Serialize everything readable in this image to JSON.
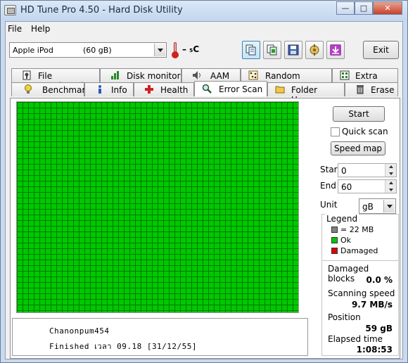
{
  "window": {
    "title": "HD Tune Pro 4.50 - Hard Disk Utility"
  },
  "titlebar_buttons": {
    "minimize": "—",
    "maximize": "□",
    "close": "✕"
  },
  "menu": {
    "file": "File",
    "help": "Help"
  },
  "toolbar": {
    "disk_name": "Apple   iPod",
    "disk_size": "(60 gB)",
    "temperature": "– ₅C",
    "exit_label": "Exit"
  },
  "tabs_top": [
    {
      "label": "File Benchmark",
      "icon": "file-benchmark-icon"
    },
    {
      "label": "Disk monitor",
      "icon": "disk-monitor-icon"
    },
    {
      "label": "AAM",
      "icon": "speaker-icon"
    },
    {
      "label": "Random Access",
      "icon": "random-access-icon"
    },
    {
      "label": "Extra tests",
      "icon": "extra-tests-icon"
    }
  ],
  "tabs_bottom": [
    {
      "label": "Benchmark",
      "icon": "lightbulb-icon"
    },
    {
      "label": "Info",
      "icon": "info-icon"
    },
    {
      "label": "Health",
      "icon": "health-cross-icon"
    },
    {
      "label": "Error Scan",
      "icon": "magnifier-icon",
      "selected": true
    },
    {
      "label": "Folder Usage",
      "icon": "folder-icon"
    },
    {
      "label": "Erase",
      "icon": "trash-icon"
    }
  ],
  "scan": {
    "start_button": "Start",
    "quick_scan_label": "Quick scan",
    "quick_scan_checked": false,
    "speed_map_button": "Speed map",
    "start_label": "Start",
    "start_value": "0",
    "end_label": "End",
    "end_value": "60",
    "unit_label": "Unit",
    "unit_value": "gB",
    "grid_status": "ok",
    "grid_color": "#00c800"
  },
  "legend": {
    "title": "Legend",
    "items": [
      {
        "label": "= 22 MB",
        "color": "#808080"
      },
      {
        "label": "Ok",
        "color": "#00c800"
      },
      {
        "label": "Damaged",
        "color": "#e00000"
      }
    ]
  },
  "stats": {
    "damaged_blocks_label": "Damaged blocks",
    "damaged_blocks_value": "0.0 %",
    "scanning_speed_label": "Scanning speed",
    "scanning_speed_value": "9.7 MB/s",
    "position_label": "Position",
    "position_value": "59 gB",
    "elapsed_label": "Elapsed time",
    "elapsed_value": "1:08:53"
  },
  "info_box": {
    "line1": "Chanonpum454",
    "line2": "Finished เวลา 09.18  [31/12/55]"
  }
}
